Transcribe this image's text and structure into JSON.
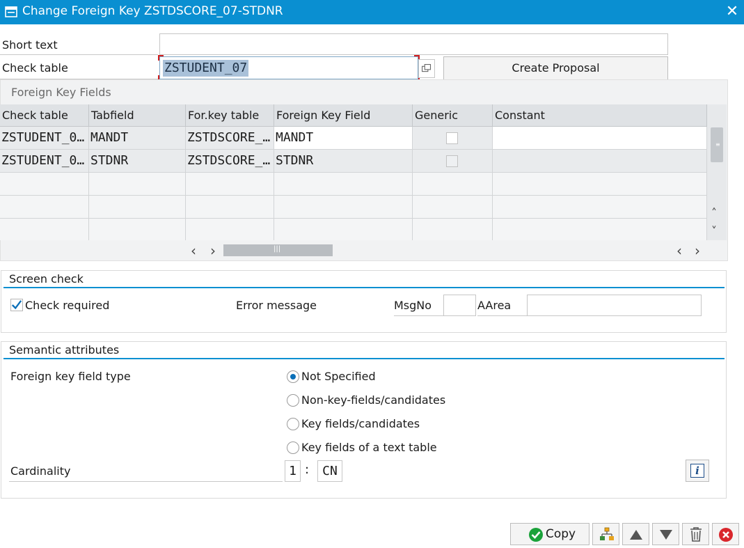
{
  "window": {
    "title": "Change Foreign Key ZSTDSCORE_07-STDNR",
    "close_glyph": "✕"
  },
  "form": {
    "short_text_label": "Short text",
    "short_text_value": "",
    "check_table_label": "Check table",
    "check_table_value": "ZSTUDENT_07",
    "create_proposal_label": "Create Proposal"
  },
  "fk_fields": {
    "group_title": "Foreign Key Fields",
    "columns": [
      "Check table",
      "Tabfield",
      "For.key table",
      "Foreign Key Field",
      "Generic",
      "Constant"
    ],
    "rows": [
      {
        "check_table": "ZSTUDENT_0…",
        "tabfield": "MANDT",
        "for_key_table": "ZSTDSCORE_…",
        "fk_field": "MANDT",
        "generic": false,
        "constant": ""
      },
      {
        "check_table": "ZSTUDENT_0…",
        "tabfield": "STDNR",
        "for_key_table": "ZSTDSCORE_…",
        "fk_field": "STDNR",
        "generic": false,
        "constant": ""
      }
    ],
    "scroll_left": "‹",
    "scroll_right": "›",
    "scroll_up": "˄",
    "scroll_down": "˅"
  },
  "screen_check": {
    "title": "Screen check",
    "check_required_label": "Check required",
    "check_required": true,
    "error_message_label": "Error message",
    "msgno_label": "MsgNo",
    "msgno_value": "",
    "aarea_label": "AArea",
    "aarea_value": ""
  },
  "semantic": {
    "title": "Semantic attributes",
    "fk_field_type_label": "Foreign key field type",
    "options": [
      {
        "label": "Not Specified",
        "selected": true
      },
      {
        "label": "Non-key-fields/candidates",
        "selected": false
      },
      {
        "label": "Key fields/candidates",
        "selected": false
      },
      {
        "label": "Key fields of a text table",
        "selected": false
      }
    ],
    "cardinality_label": "Cardinality",
    "cardinality_left": "1",
    "cardinality_sep": ":",
    "cardinality_right": "CN",
    "info_glyph": "i"
  },
  "toolbar": {
    "copy_label": "Copy"
  },
  "colors": {
    "accent": "#0a8fd1",
    "ok_green": "#1aa23a",
    "cancel_red": "#d9262c"
  }
}
